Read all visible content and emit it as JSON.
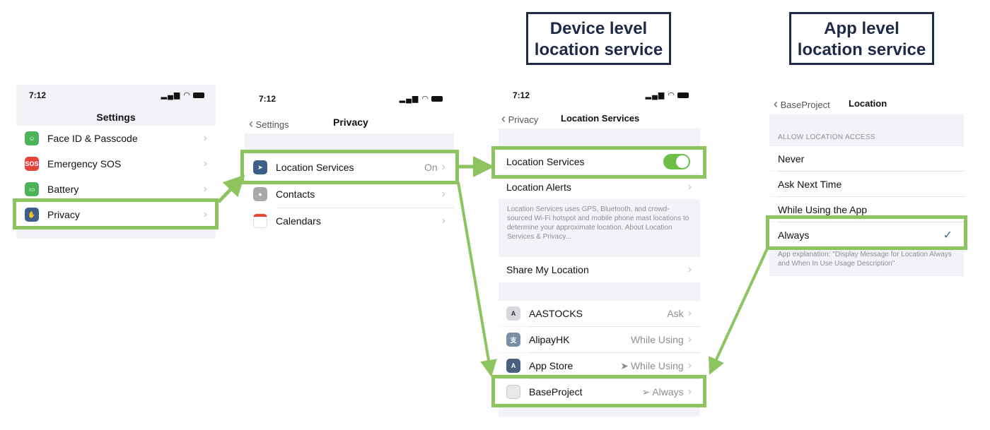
{
  "callouts": {
    "device": [
      "Device level",
      "location service"
    ],
    "app": [
      "App level",
      "location service"
    ]
  },
  "screen1": {
    "time": "7:12",
    "title": "Settings",
    "items": [
      {
        "label": "Face ID & Passcode",
        "icon": "face-id-icon",
        "color": "#4cb35a"
      },
      {
        "label": "Emergency SOS",
        "icon": "sos-icon",
        "color": "#e5443b",
        "icon_text": "SOS"
      },
      {
        "label": "Battery",
        "icon": "battery-icon",
        "color": "#4cb35a"
      },
      {
        "label": "Privacy",
        "icon": "hand-icon",
        "color": "#3d5f8a"
      }
    ]
  },
  "screen2": {
    "time": "7:12",
    "back": "Settings",
    "title": "Privacy",
    "items": [
      {
        "label": "Location Services",
        "value": "On",
        "icon": "location-arrow-icon",
        "color": "#3d5f8a"
      },
      {
        "label": "Contacts",
        "icon": "contacts-icon",
        "color": "#a9a9ad"
      },
      {
        "label": "Calendars",
        "icon": "calendar-icon",
        "color": "#ffffff"
      }
    ]
  },
  "screen3": {
    "time": "7:12",
    "back": "Privacy",
    "title": "Location Services",
    "toggle_label": "Location Services",
    "alerts_label": "Location Alerts",
    "description": "Location Services uses GPS, Bluetooth, and crowd-sourced Wi-Fi hotspot and mobile phone mast locations to determine your approximate location. About Location Services & Privacy...",
    "share_label": "Share My Location",
    "apps": [
      {
        "label": "AASTOCKS",
        "value": "Ask",
        "icon": "aastocks-icon",
        "color": "#d8d8dc"
      },
      {
        "label": "AlipayHK",
        "value": "While Using",
        "icon": "alipay-icon",
        "color": "#7a8fa6"
      },
      {
        "label": "App Store",
        "value": "While Using",
        "icon": "app-store-icon",
        "color": "#4a6080"
      },
      {
        "label": "BaseProject",
        "value": "Always",
        "icon": "baseproject-icon",
        "color": "#e8e8ea"
      }
    ]
  },
  "screen4": {
    "back": "BaseProject",
    "title": "Location",
    "section": "ALLOW LOCATION ACCESS",
    "options": [
      "Never",
      "Ask Next Time",
      "While Using the App",
      "Always"
    ],
    "checkmark": "✓",
    "explanation": "App explanation: \"Display Message for Location Always and When In Use Usage Description\""
  },
  "colors": {
    "highlight": "#8dc45f",
    "callout_border": "#1e2a48",
    "toggle_on": "#6cc04a"
  }
}
